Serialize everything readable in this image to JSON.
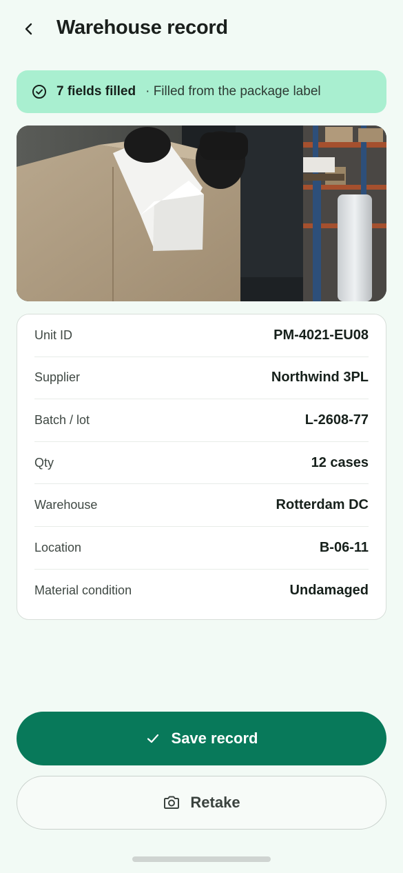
{
  "header": {
    "title": "Warehouse record",
    "back_icon": "chevron-left-icon"
  },
  "banner": {
    "icon": "check-circle-icon",
    "count_text": "7 fields filled",
    "source_text": "· Filled from the package label"
  },
  "photo": {
    "description_icon": "package-label-photo"
  },
  "fields": [
    {
      "label": "Unit ID",
      "value": "PM-4021-EU08"
    },
    {
      "label": "Supplier",
      "value": "Northwind 3PL"
    },
    {
      "label": "Batch / lot",
      "value": "L-2608-77"
    },
    {
      "label": "Qty",
      "value": "12 cases"
    },
    {
      "label": "Warehouse",
      "value": "Rotterdam DC"
    },
    {
      "label": "Location",
      "value": "B-06-11"
    },
    {
      "label": "Material condition",
      "value": "Undamaged"
    }
  ],
  "actions": {
    "save_label": "Save record",
    "save_icon": "check-icon",
    "retake_label": "Retake",
    "retake_icon": "camera-icon"
  },
  "colors": {
    "background": "#f2faf5",
    "banner": "#a9efd0",
    "primary": "#08795a"
  }
}
